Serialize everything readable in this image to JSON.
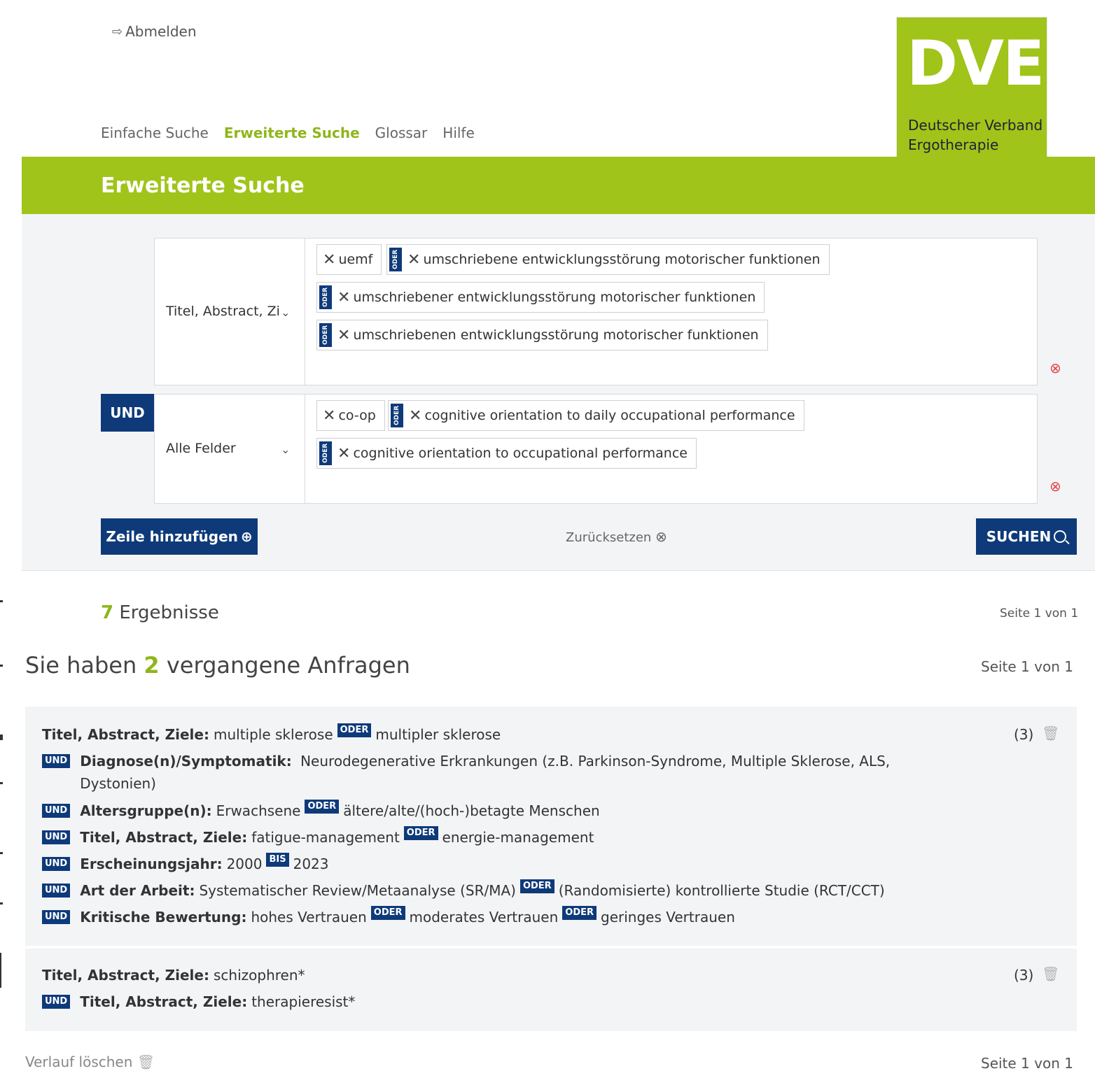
{
  "header": {
    "logout_label": "Abmelden",
    "logo_text": "DVE",
    "logo_sub_1": "Deutscher Verband",
    "logo_sub_2": "Ergotherapie"
  },
  "nav": {
    "items": [
      "Einfache Suche",
      "Erweiterte Suche",
      "Glossar",
      "Hilfe"
    ],
    "active_index": 1
  },
  "banner": {
    "title": "Erweiterte Suche"
  },
  "search": {
    "rows": [
      {
        "field": "Titel, Abstract, Zi",
        "terms": [
          "uemf",
          "umschriebene entwicklungsstörung motorischer funktionen",
          "umschriebener entwicklungsstörung motorischer funktionen",
          "umschriebenen entwicklungsstörung motorischer funktionen"
        ]
      },
      {
        "operator": "UND",
        "field": "Alle Felder",
        "terms": [
          "co-op",
          "cognitive orientation to daily occupational performance",
          "cognitive orientation to occupational performance"
        ]
      }
    ],
    "oder_label": "ODER",
    "add_row_label": "Zeile hinzufügen",
    "reset_label": "Zurücksetzen",
    "search_label": "SUCHEN"
  },
  "results": {
    "count": "7",
    "label": "Ergebnisse",
    "page": "Seite 1 von 1"
  },
  "history": {
    "prefix": "Sie haben",
    "count": "2",
    "suffix": "vergangene Anfragen",
    "page": "Seite 1 von 1",
    "queries": [
      {
        "count": "(3)",
        "lines": [
          {
            "op": "",
            "label": "Titel, Abstract, Ziele:",
            "v1": "multiple sklerose",
            "join": "ODER",
            "v2": "multipler sklerose"
          },
          {
            "op": "UND",
            "label": "Diagnose(n)/Symptomatik:",
            "v1": "Neurodegenerative Erkrankungen (z.B. Parkinson-Syndrome, Multiple Sklerose, ALS,",
            "v1b": "Dystonien)"
          },
          {
            "op": "UND",
            "label": "Altersgruppe(n):",
            "v1": "Erwachsene",
            "join": "ODER",
            "v2": "ältere/alte/(hoch-)betagte Menschen"
          },
          {
            "op": "UND",
            "label": "Titel, Abstract, Ziele:",
            "v1": "fatigue-management",
            "join": "ODER",
            "v2": "energie-management"
          },
          {
            "op": "UND",
            "label": "Erscheinungsjahr:",
            "v1": "2000",
            "join": "BIS",
            "v2": "2023"
          },
          {
            "op": "UND",
            "label": "Art der Arbeit:",
            "v1": "Systematischer Review/Metaanalyse (SR/MA)",
            "join": "ODER",
            "v2": "(Randomisierte) kontrollierte Studie (RCT/CCT)"
          },
          {
            "op": "UND",
            "label": "Kritische Bewertung:",
            "v1": "hohes Vertrauen",
            "join": "ODER",
            "v2": "moderates Vertrauen",
            "join2": "ODER",
            "v3": "geringes Vertrauen"
          }
        ]
      },
      {
        "count": "(3)",
        "lines": [
          {
            "op": "",
            "label": "Titel, Abstract, Ziele:",
            "v1": "schizophren*"
          },
          {
            "op": "UND",
            "label": "Titel, Abstract, Ziele:",
            "v1": "therapieresist*"
          }
        ]
      }
    ],
    "clear_label": "Verlauf löschen",
    "footer_page": "Seite 1 von 1"
  }
}
